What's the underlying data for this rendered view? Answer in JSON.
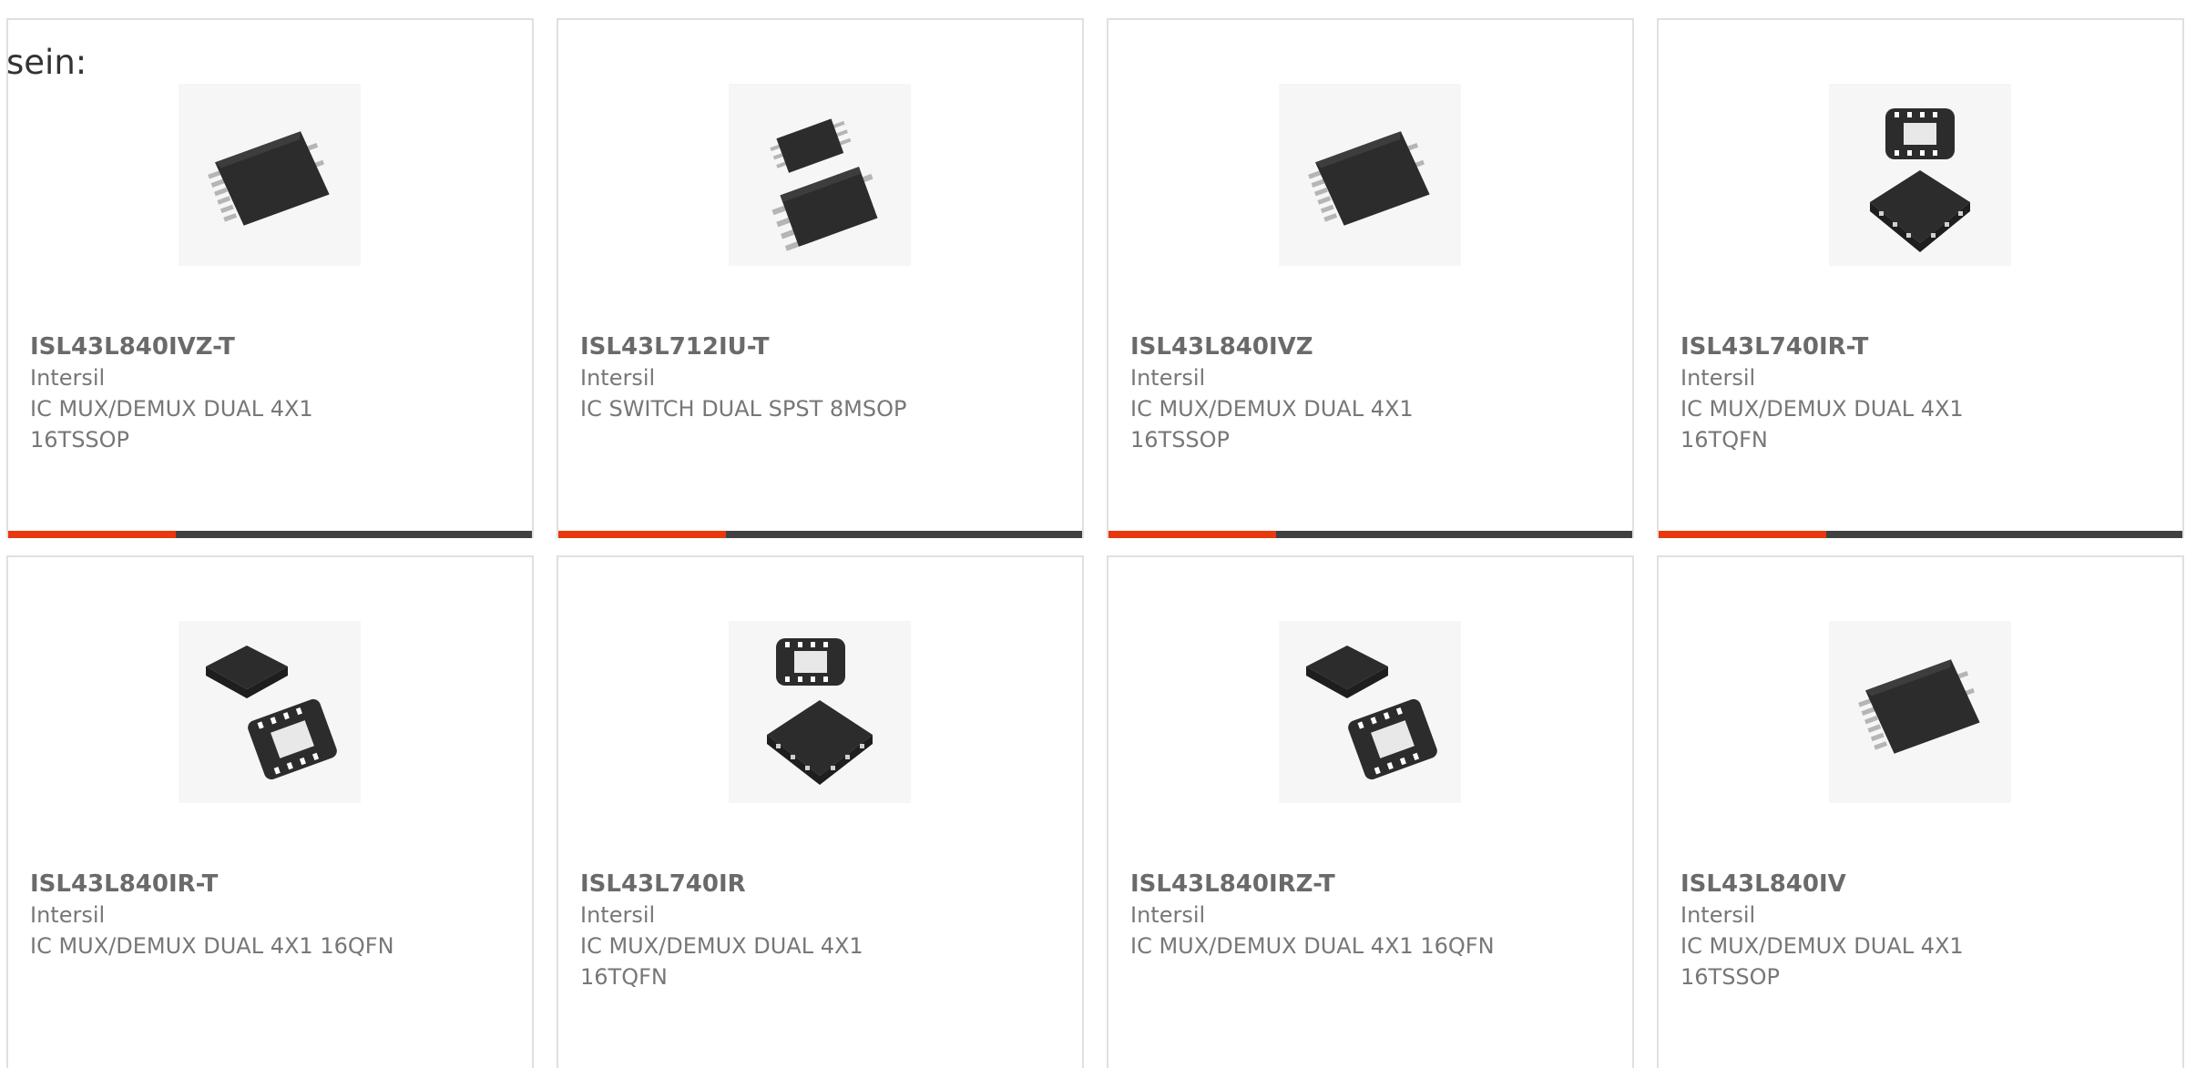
{
  "intro_text": "sein:",
  "colors": {
    "accent": "#e8380d",
    "bar_dark": "#404040",
    "card_border": "#e0e0e0",
    "text_gray": "#707070"
  },
  "products": [
    {
      "part": "ISL43L840IVZ-T",
      "manufacturer": "Intersil",
      "description": "IC MUX/DEMUX DUAL 4X1 16TSSOP",
      "image": "tssop-chip-icon"
    },
    {
      "part": "ISL43L712IU-T",
      "manufacturer": "Intersil",
      "description": "IC SWITCH DUAL SPST 8MSOP",
      "image": "msop-chip-icon"
    },
    {
      "part": "ISL43L840IVZ",
      "manufacturer": "Intersil",
      "description": "IC MUX/DEMUX DUAL 4X1 16TSSOP",
      "image": "tssop-chip-icon"
    },
    {
      "part": "ISL43L740IR-T",
      "manufacturer": "Intersil",
      "description": "IC MUX/DEMUX DUAL 4X1 16TQFN",
      "image": "qfn-chip-icon"
    },
    {
      "part": "ISL43L840IR-T",
      "manufacturer": "Intersil",
      "description": "IC MUX/DEMUX DUAL 4X1 16QFN",
      "image": "qfn-chip-icon"
    },
    {
      "part": "ISL43L740IR",
      "manufacturer": "Intersil",
      "description": "IC MUX/DEMUX DUAL 4X1 16TQFN",
      "image": "qfn-chip-icon"
    },
    {
      "part": "ISL43L840IRZ-T",
      "manufacturer": "Intersil",
      "description": "IC MUX/DEMUX DUAL 4X1 16QFN",
      "image": "qfn-chip-icon"
    },
    {
      "part": "ISL43L840IV",
      "manufacturer": "Intersil",
      "description": "IC MUX/DEMUX DUAL 4X1 16TSSOP",
      "image": "tssop-chip-icon"
    }
  ]
}
